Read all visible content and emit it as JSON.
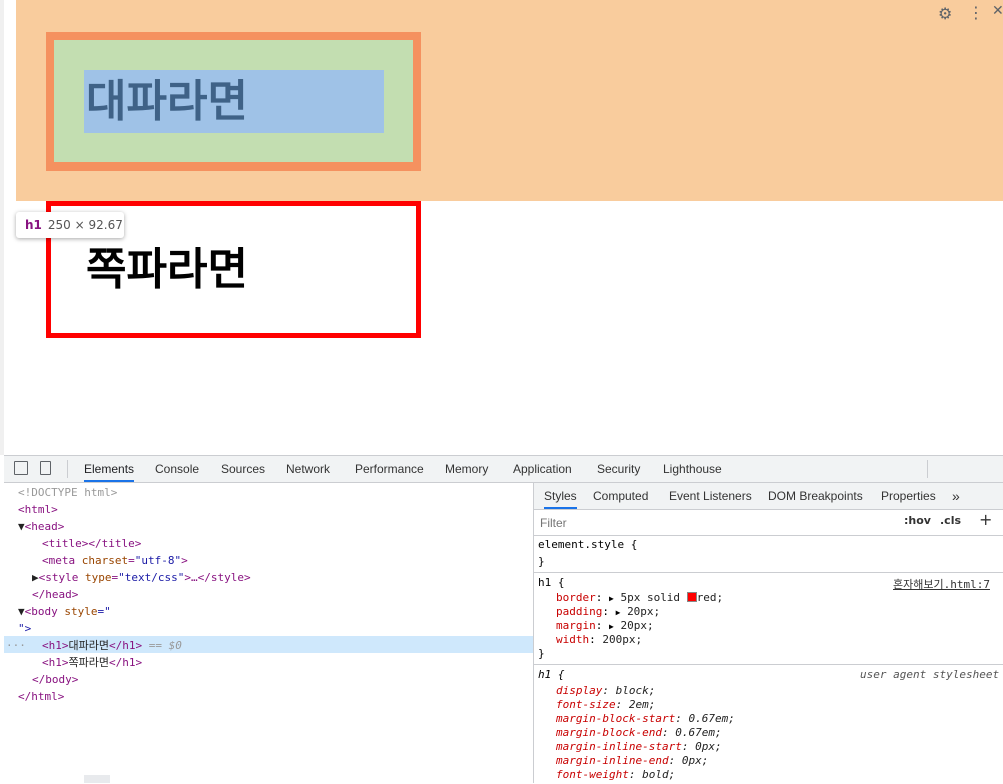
{
  "page": {
    "h1_first": "대파라면",
    "h1_second": "쪽파라면"
  },
  "tooltip": {
    "tag": "h1",
    "dims": "250 × 92.67"
  },
  "devtools": {
    "tabs": [
      "Elements",
      "Console",
      "Sources",
      "Network",
      "Performance",
      "Memory",
      "Application",
      "Security",
      "Lighthouse"
    ],
    "active_tab": "Elements",
    "dom": {
      "doctype": "<!DOCTYPE html>",
      "html_open": "<html>",
      "head_open": "<head>",
      "title": "<title></title>",
      "meta_tag": "<meta ",
      "meta_attr": "charset",
      "meta_val": "\"utf-8\"",
      "meta_close": ">",
      "style_tag": "<style ",
      "style_attr": "type",
      "style_val": "\"text/css\"",
      "style_close": ">…</style>",
      "head_close": "</head>",
      "body_tag": "<body ",
      "body_attr": "style",
      "body_val": "=\"",
      "body_cont": "\">",
      "h1a_open": "<h1>",
      "h1a_text": "대파라면",
      "h1a_close": "</h1>",
      "h1a_marker": "== $0",
      "h1b_open": "<h1>",
      "h1b_text": "쪽파라면",
      "h1b_close": "</h1>",
      "body_close": "</body>",
      "html_close": "</html>",
      "ellipsis": "···"
    },
    "styles": {
      "tabs": [
        "Styles",
        "Computed",
        "Event Listeners",
        "DOM Breakpoints",
        "Properties"
      ],
      "more": "»",
      "filter_placeholder": "Filter",
      "hov": ":hov",
      "cls": ".cls",
      "plus": "+",
      "element_style": "element.style {",
      "close_brace": "}",
      "rule1_selector": "h1 {",
      "rule1_source": "혼자해보기.html:7",
      "rule1_props": [
        {
          "name": "border",
          "value": "5px solid ",
          "extra": "red;"
        },
        {
          "name": "padding",
          "value": "20px;"
        },
        {
          "name": "margin",
          "value": "20px;"
        },
        {
          "name": "width",
          "value": "200px;"
        }
      ],
      "rule2_selector": "h1 {",
      "rule2_source": "user agent stylesheet",
      "rule2_props": [
        {
          "name": "display",
          "value": "block;"
        },
        {
          "name": "font-size",
          "value": "2em;"
        },
        {
          "name": "margin-block-start",
          "value": "0.67em;"
        },
        {
          "name": "margin-block-end",
          "value": "0.67em;"
        },
        {
          "name": "margin-inline-start",
          "value": "0px;"
        },
        {
          "name": "margin-inline-end",
          "value": "0px;"
        },
        {
          "name": "font-weight",
          "value": "bold;"
        }
      ],
      "swatch_color": "#ff0000"
    }
  },
  "colors": {
    "margin": "#f9cc9d",
    "border": "#f5915f",
    "padding": "#c3deb1",
    "content": "#9fc2e7",
    "accent": "#1a73e8"
  }
}
